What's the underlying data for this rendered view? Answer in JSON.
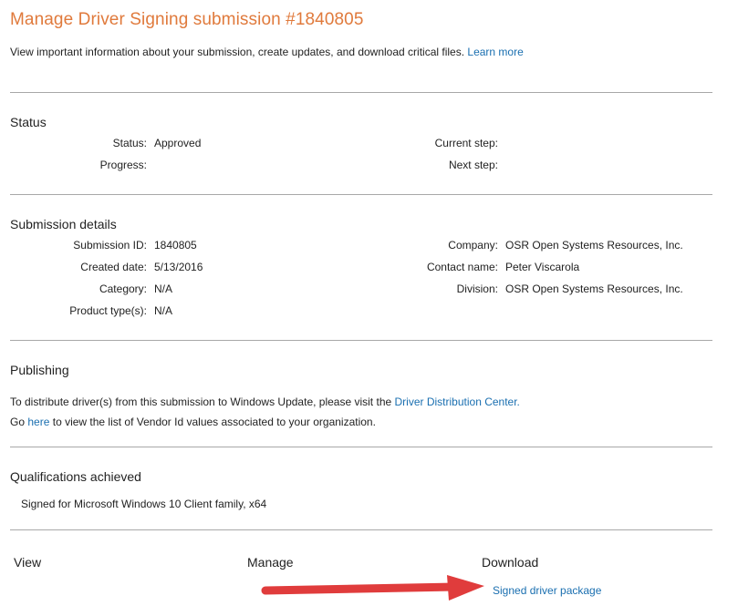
{
  "page": {
    "title": "Manage Driver Signing submission #1840805",
    "intro": "View important information about your submission, create updates, and download critical files.",
    "learn_more": "Learn more"
  },
  "status": {
    "heading": "Status",
    "status_label": "Status:",
    "status_value": "Approved",
    "progress_label": "Progress:",
    "progress_value": "",
    "current_step_label": "Current step:",
    "current_step_value": "",
    "next_step_label": "Next step:",
    "next_step_value": ""
  },
  "details": {
    "heading": "Submission details",
    "submission_id_label": "Submission ID:",
    "submission_id_value": "1840805",
    "created_label": "Created date:",
    "created_value": "5/13/2016",
    "category_label": "Category:",
    "category_value": "N/A",
    "product_type_label": "Product type(s):",
    "product_type_value": "N/A",
    "company_label": "Company:",
    "company_value": "OSR Open Systems Resources, Inc.",
    "contact_label": "Contact name:",
    "contact_value": "Peter Viscarola",
    "division_label": "Division:",
    "division_value": "OSR Open Systems Resources, Inc."
  },
  "publishing": {
    "heading": "Publishing",
    "line1_text": "To distribute driver(s) from this submission to Windows Update, please visit the",
    "line1_link": "Driver Distribution Center.",
    "line2_pre": "Go",
    "line2_link": "here",
    "line2_post": "to view the list of Vendor Id values associated to your organization."
  },
  "qualifications": {
    "heading": "Qualifications achieved",
    "item": "Signed for Microsoft Windows 10 Client family, x64"
  },
  "actions": {
    "view": "View",
    "manage": "Manage",
    "download": "Download",
    "signed_package": "Signed driver package"
  },
  "colors": {
    "title": "#e07a3c",
    "link": "#1a6fb0",
    "arrow": "#e03c3c"
  }
}
